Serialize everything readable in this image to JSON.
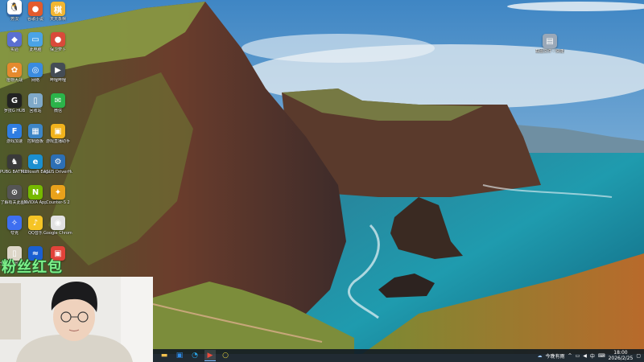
{
  "desktop": {
    "icons": [
      {
        "label": "芳汉",
        "color": "#3b7bd6",
        "glyph": "人"
      },
      {
        "label": "谷歌小说",
        "color": "#e35b2c",
        "glyph": "●"
      },
      {
        "label": "天天象棋",
        "color": "#f2b632",
        "glyph": "棋"
      },
      {
        "label": "实验",
        "color": "#5a6fd1",
        "glyph": "◆"
      },
      {
        "label": "此电脑",
        "color": "#4aa3e6",
        "glyph": "▭"
      },
      {
        "label": "保卫萝卜",
        "color": "#d94a3a",
        "glyph": "●"
      },
      {
        "label": "植物大战",
        "color": "#e58a2e",
        "glyph": "✿"
      },
      {
        "label": "网络",
        "color": "#3a8be0",
        "glyph": "◎"
      },
      {
        "label": "哔哩哔哩",
        "color": "#444c55",
        "glyph": "▶"
      },
      {
        "label": "罗技G HUB",
        "color": "#222",
        "glyph": "G"
      },
      {
        "label": "回收站",
        "color": "#7fa9c9",
        "glyph": "▯"
      },
      {
        "label": "微信",
        "color": "#2bb44a",
        "glyph": "✉"
      },
      {
        "label": "游戏加速",
        "color": "#2f7de1",
        "glyph": "F"
      },
      {
        "label": "控制面板",
        "color": "#3d85c6",
        "glyph": "▦"
      },
      {
        "label": "游戏直播助手",
        "color": "#f0b21c",
        "glyph": "▣"
      },
      {
        "label": "PUBG BATTLEGR",
        "color": "#3a3a3a",
        "glyph": "♞"
      },
      {
        "label": "Microsoft Edge",
        "color": "#1b8fd0",
        "glyph": "e"
      },
      {
        "label": "ASUS DriverHub",
        "color": "#2d6fb5",
        "glyph": "⚙"
      },
      {
        "label": "了解有关此图片",
        "color": "#555",
        "glyph": "⊙"
      },
      {
        "label": "NVIDIA App",
        "color": "#76b900",
        "glyph": "N"
      },
      {
        "label": "Counter-S 2",
        "color": "#e9a21b",
        "glyph": "✦"
      },
      {
        "label": "夸克",
        "color": "#3e6ff0",
        "glyph": "✧"
      },
      {
        "label": "QQ音乐",
        "color": "#f5c425",
        "glyph": "♪"
      },
      {
        "label": "Google Chrome",
        "color": "#e2e2e2",
        "glyph": "◉"
      },
      {
        "label": "全部应用快捷 (1)",
        "color": "#ddd6c8",
        "glyph": "▯"
      },
      {
        "label": "",
        "color": "#1a5fd1",
        "glyph": "≈"
      },
      {
        "label": "",
        "color": "#e2433a",
        "glyph": "▣"
      },
      {
        "label": "",
        "color": "#ffffff",
        "glyph": "🐧"
      }
    ],
    "right_icon": {
      "label": "截图文件 - 快捷方式",
      "color": "#9aa8b8",
      "glyph": "▤"
    }
  },
  "overlay_text": "粉丝红包",
  "taskbar": {
    "apps": [
      {
        "name": "file-explorer",
        "glyph": "▬",
        "color": "#f2c14e"
      },
      {
        "name": "store",
        "glyph": "▣",
        "color": "#2e8ae6"
      },
      {
        "name": "edge",
        "glyph": "◔",
        "color": "#29a4e6"
      },
      {
        "name": "media",
        "glyph": "▶",
        "color": "#e84c3d"
      },
      {
        "name": "search",
        "glyph": "○",
        "color": "#e8d53d"
      }
    ],
    "weather": "今晚有雨",
    "tray_chevron": "^",
    "ime": "中",
    "time": "18:00",
    "date": "2026/2/25"
  }
}
